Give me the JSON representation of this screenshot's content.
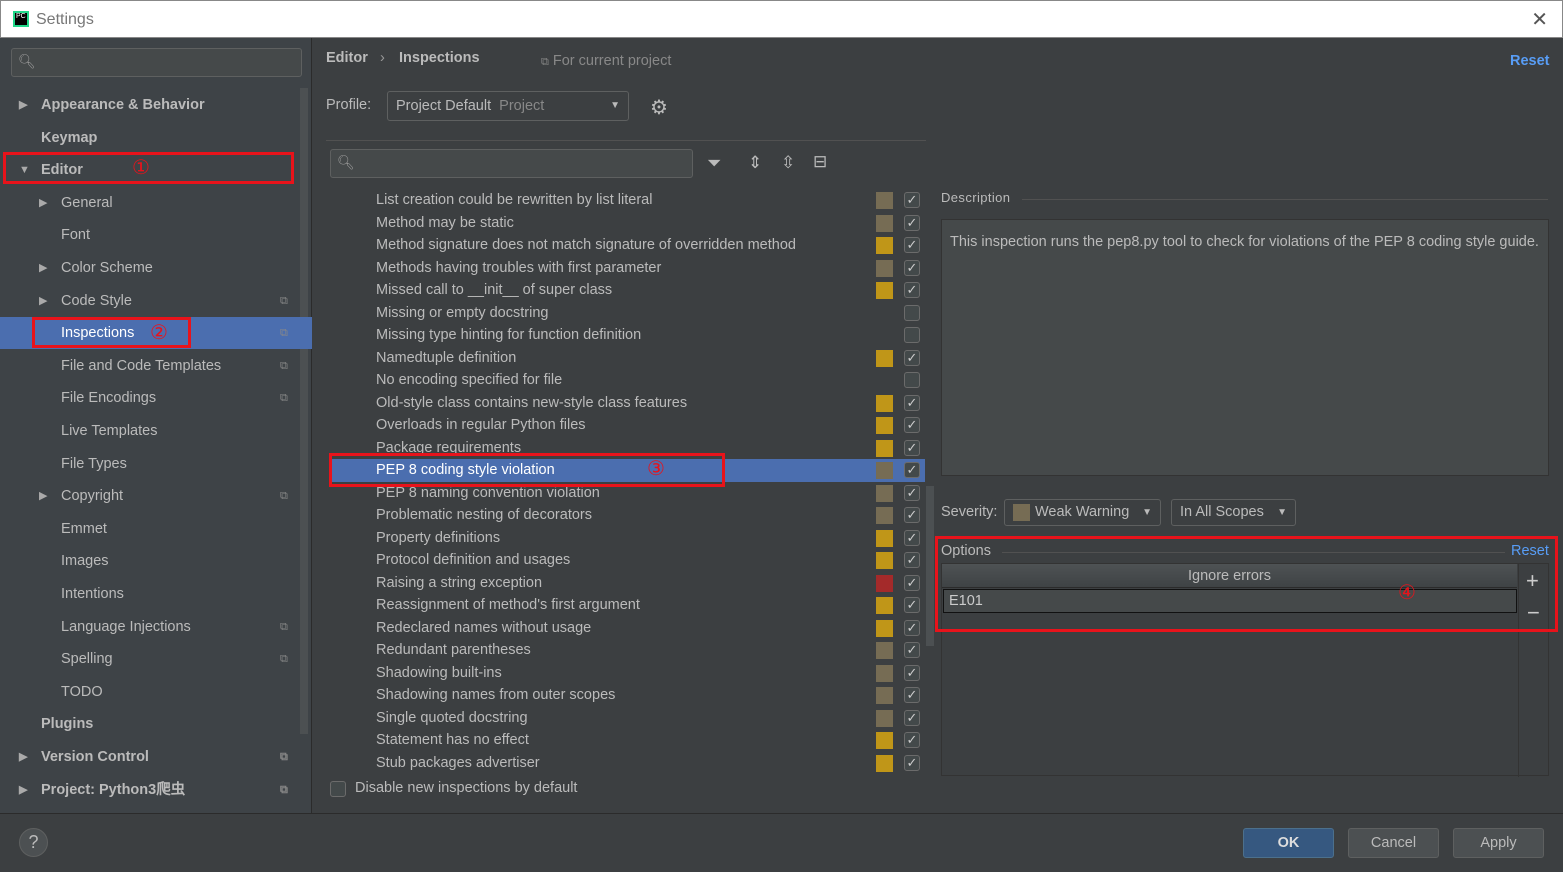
{
  "window": {
    "title": "Settings",
    "logo": "PC",
    "close_icon": "close-icon"
  },
  "sidebar": {
    "search_placeholder": "",
    "items": [
      {
        "label": "Appearance & Behavior",
        "bold": true,
        "arrow": "▶",
        "level": 0,
        "copy": false
      },
      {
        "label": "Keymap",
        "bold": true,
        "arrow": "",
        "level": 0,
        "copy": false
      },
      {
        "label": "Editor",
        "bold": true,
        "arrow": "▼",
        "level": 0,
        "copy": false
      },
      {
        "label": "General",
        "arrow": "▶",
        "level": 1,
        "copy": false
      },
      {
        "label": "Font",
        "arrow": "",
        "level": 1,
        "copy": false
      },
      {
        "label": "Color Scheme",
        "arrow": "▶",
        "level": 1,
        "copy": false
      },
      {
        "label": "Code Style",
        "arrow": "▶",
        "level": 1,
        "copy": true
      },
      {
        "label": "Inspections",
        "arrow": "",
        "level": 1,
        "copy": true,
        "selected": true
      },
      {
        "label": "File and Code Templates",
        "arrow": "",
        "level": 1,
        "copy": true
      },
      {
        "label": "File Encodings",
        "arrow": "",
        "level": 1,
        "copy": true
      },
      {
        "label": "Live Templates",
        "arrow": "",
        "level": 1,
        "copy": false
      },
      {
        "label": "File Types",
        "arrow": "",
        "level": 1,
        "copy": false
      },
      {
        "label": "Copyright",
        "arrow": "▶",
        "level": 1,
        "copy": true
      },
      {
        "label": "Emmet",
        "arrow": "",
        "level": 1,
        "copy": false
      },
      {
        "label": "Images",
        "arrow": "",
        "level": 1,
        "copy": false
      },
      {
        "label": "Intentions",
        "arrow": "",
        "level": 1,
        "copy": false
      },
      {
        "label": "Language Injections",
        "arrow": "",
        "level": 1,
        "copy": true
      },
      {
        "label": "Spelling",
        "arrow": "",
        "level": 1,
        "copy": true
      },
      {
        "label": "TODO",
        "arrow": "",
        "level": 1,
        "copy": false
      },
      {
        "label": "Plugins",
        "bold": true,
        "arrow": "",
        "level": 0,
        "copy": false
      },
      {
        "label": "Version Control",
        "bold": true,
        "arrow": "▶",
        "level": 0,
        "copy": true
      },
      {
        "label": "Project: Python3爬虫",
        "bold": true,
        "arrow": "▶",
        "level": 0,
        "copy": true
      }
    ]
  },
  "annotations": [
    "①",
    "②",
    "③",
    "④"
  ],
  "breadcrumb": {
    "parent": "Editor",
    "sep": "›",
    "current": "Inspections",
    "scope": "For current project",
    "reset": "Reset"
  },
  "profile": {
    "label": "Profile:",
    "value": "Project Default",
    "kind": "Project"
  },
  "colors": {
    "weak": "#766c54",
    "warning": "#c09618",
    "error": "#a42a2a",
    "selected": "#4b6eaf",
    "link": "#589df6",
    "annotation": "#e8131b"
  },
  "inspections": [
    {
      "label": "List creation could be rewritten by list literal",
      "severity": "weak",
      "checked": true
    },
    {
      "label": "Method may be static",
      "severity": "weak",
      "checked": true
    },
    {
      "label": "Method signature does not match signature of overridden method",
      "severity": "warning",
      "checked": true
    },
    {
      "label": "Methods having troubles with first parameter",
      "severity": "weak",
      "checked": true
    },
    {
      "label": "Missed call to __init__ of super class",
      "severity": "warning",
      "checked": true
    },
    {
      "label": "Missing or empty docstring",
      "severity": "",
      "checked": false
    },
    {
      "label": "Missing type hinting for function definition",
      "severity": "",
      "checked": false
    },
    {
      "label": "Namedtuple definition",
      "severity": "warning",
      "checked": true
    },
    {
      "label": "No encoding specified for file",
      "severity": "",
      "checked": false
    },
    {
      "label": "Old-style class contains new-style class features",
      "severity": "warning",
      "checked": true
    },
    {
      "label": "Overloads in regular Python files",
      "severity": "warning",
      "checked": true
    },
    {
      "label": "Package requirements",
      "severity": "warning",
      "checked": true
    },
    {
      "label": "PEP 8 coding style violation",
      "severity": "weak",
      "checked": true,
      "selected": true
    },
    {
      "label": "PEP 8 naming convention violation",
      "severity": "weak",
      "checked": true
    },
    {
      "label": "Problematic nesting of decorators",
      "severity": "weak",
      "checked": true
    },
    {
      "label": "Property definitions",
      "severity": "warning",
      "checked": true
    },
    {
      "label": "Protocol definition and usages",
      "severity": "warning",
      "checked": true
    },
    {
      "label": "Raising a string exception",
      "severity": "error",
      "checked": true
    },
    {
      "label": "Reassignment of method's first argument",
      "severity": "warning",
      "checked": true
    },
    {
      "label": "Redeclared names without usage",
      "severity": "warning",
      "checked": true
    },
    {
      "label": "Redundant parentheses",
      "severity": "weak",
      "checked": true
    },
    {
      "label": "Shadowing built-ins",
      "severity": "weak",
      "checked": true
    },
    {
      "label": "Shadowing names from outer scopes",
      "severity": "weak",
      "checked": true
    },
    {
      "label": "Single quoted docstring",
      "severity": "weak",
      "checked": true
    },
    {
      "label": "Statement has no effect",
      "severity": "warning",
      "checked": true
    },
    {
      "label": "Stub packages advertiser",
      "severity": "warning",
      "checked": true
    }
  ],
  "disable_new": {
    "label": "Disable new inspections by default",
    "checked": false
  },
  "description": {
    "title": "Description",
    "text": "This inspection runs the pep8.py tool to check for violations of the PEP 8 coding style guide."
  },
  "severity": {
    "label": "Severity:",
    "value": "Weak Warning",
    "scope": "In All Scopes"
  },
  "options": {
    "title": "Options",
    "reset": "Reset",
    "column": "Ignore errors",
    "values": [
      "E101"
    ],
    "add": "+",
    "remove": "−"
  },
  "footer": {
    "help": "?",
    "ok": "OK",
    "cancel": "Cancel",
    "apply": "Apply"
  }
}
